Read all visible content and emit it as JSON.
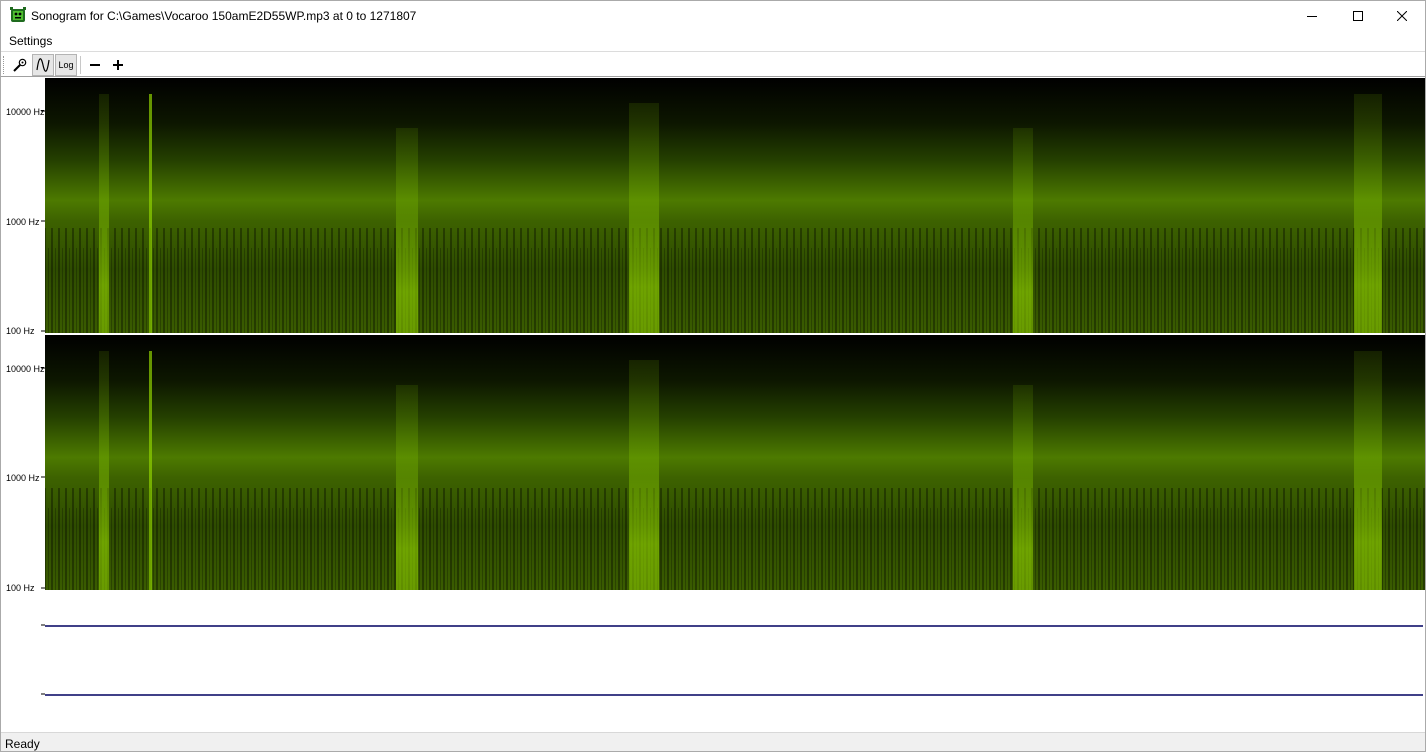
{
  "window": {
    "title": "Sonogram for C:\\Games\\Vocaroo 150amE2D55WP.mp3 at 0 to 1271807"
  },
  "titlebar_buttons": {
    "minimize": "minimize-icon",
    "maximize": "maximize-icon",
    "close": "close-icon"
  },
  "menu": {
    "settings_label": "Settings"
  },
  "toolbar": {
    "settings_icon": "wrench-icon",
    "wave_icon": "waveform-icon",
    "log_label": "Log",
    "zoom_out_icon": "minus-icon",
    "zoom_in_icon": "plus-icon"
  },
  "channels": [
    {
      "f_high": "10000 Hz",
      "f_mid": "1000 Hz",
      "f_low": "100 Hz"
    },
    {
      "f_high": "10000 Hz",
      "f_mid": "1000 Hz",
      "f_low": "100 Hz"
    }
  ],
  "colors": {
    "spectrogram_bg": "#000000",
    "spectrogram_fg": "#7ab800",
    "waveform_line": "#000060"
  },
  "status": {
    "text": "Ready"
  }
}
